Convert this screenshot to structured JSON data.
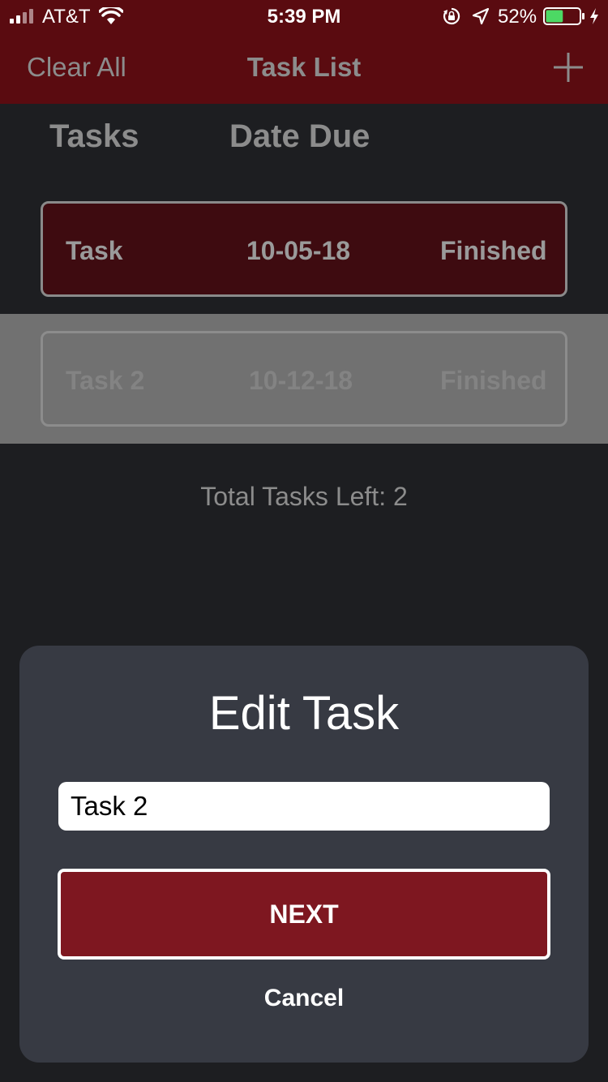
{
  "status_bar": {
    "carrier": "AT&T",
    "time": "5:39 PM",
    "battery_percent": "52%",
    "battery_level": 0.52,
    "battery_color": "#4cd964",
    "icons": [
      "signal-icon",
      "wifi-icon",
      "rotation-lock-icon",
      "location-icon",
      "battery-icon",
      "charging-icon"
    ]
  },
  "nav": {
    "left_label": "Clear All",
    "title": "Task List",
    "add_icon": "plus-icon",
    "background": "#5a0b10"
  },
  "columns": {
    "tasks": "Tasks",
    "date_due": "Date Due"
  },
  "tasks": [
    {
      "name": "Task",
      "date": "10-05-18",
      "status": "Finished",
      "selected": false
    },
    {
      "name": "Task 2",
      "date": "10-12-18",
      "status": "Finished",
      "selected": true
    }
  ],
  "total_label": "Total Tasks Left: 2",
  "dialog": {
    "title": "Edit Task",
    "input_value": "Task 2",
    "next_label": "NEXT",
    "cancel_label": "Cancel",
    "accent": "#7e1720"
  }
}
